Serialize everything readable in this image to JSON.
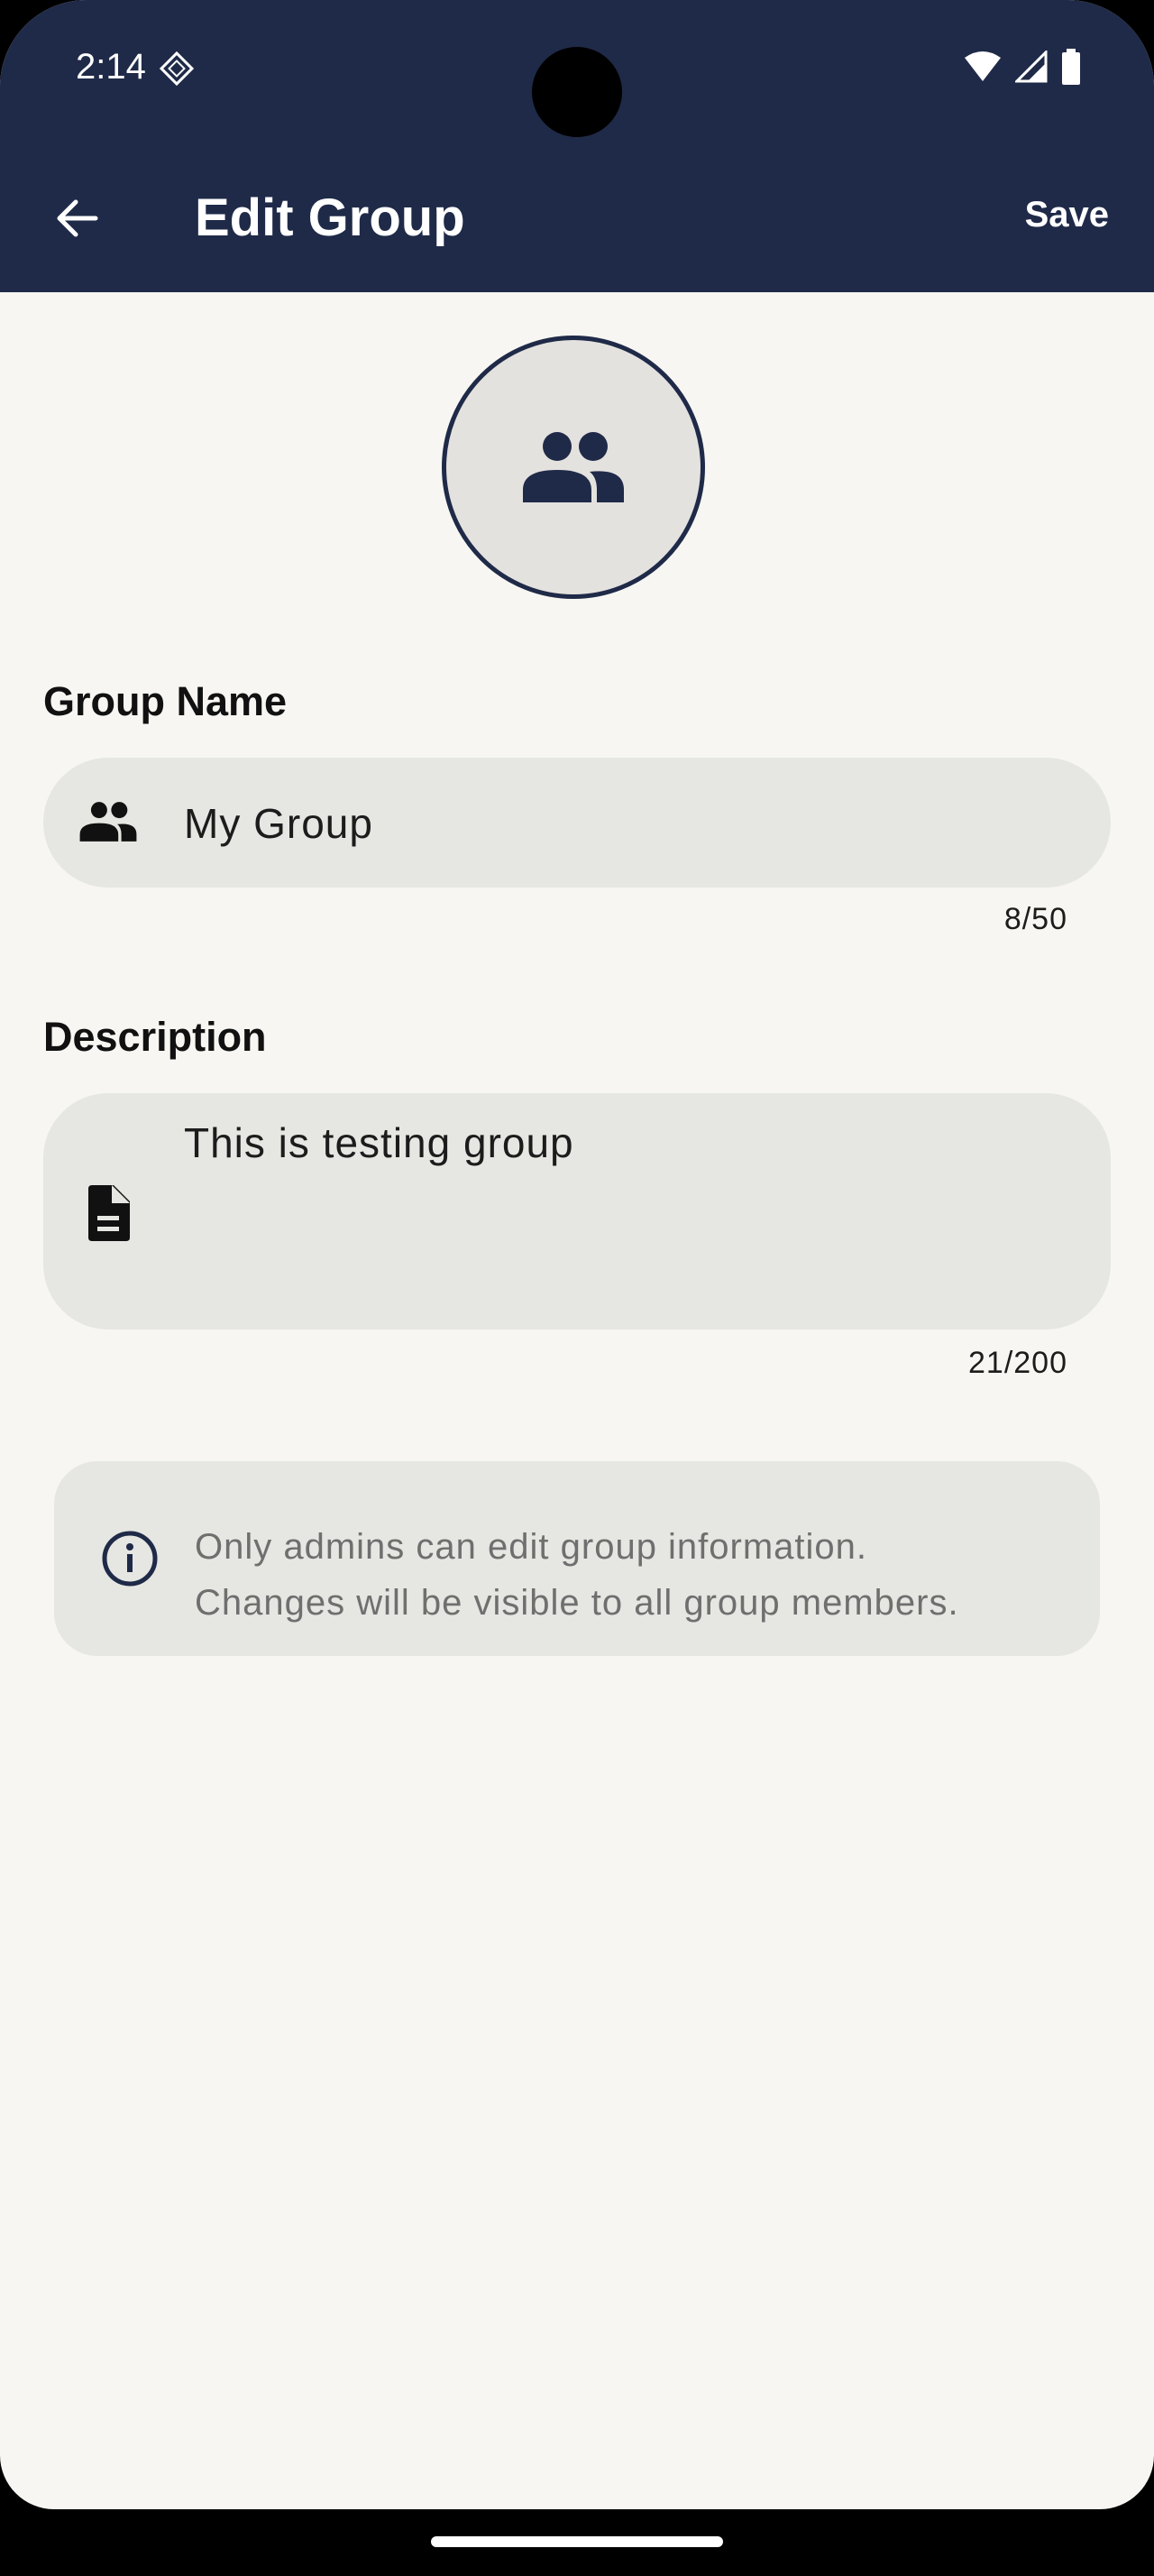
{
  "status_bar": {
    "time": "2:14"
  },
  "app_bar": {
    "title": "Edit Group",
    "save_label": "Save"
  },
  "group_name": {
    "label": "Group Name",
    "value": "My Group",
    "counter": "8/50"
  },
  "description": {
    "label": "Description",
    "value": "This is testing group",
    "counter": "21/200"
  },
  "info": {
    "line1": "Only admins can edit group information.",
    "line2": "Changes will be visible to all group members."
  },
  "colors": {
    "primary": "#1f2a48",
    "background": "#f7f6f2",
    "field": "#e6e6e2"
  },
  "icons": [
    "sim-icon",
    "wifi-icon",
    "signal-icon",
    "battery-icon",
    "back-arrow-icon",
    "group-icon",
    "document-icon",
    "info-icon"
  ]
}
